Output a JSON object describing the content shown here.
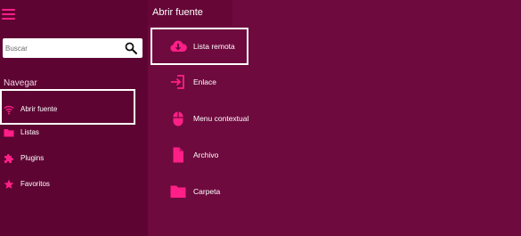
{
  "sidebar": {
    "search": {
      "placeholder": "Buscar",
      "value": ""
    },
    "nav_heading": "Navegar",
    "items": [
      {
        "label": "Abrir fuente",
        "icon": "wifi-icon"
      },
      {
        "label": "Listas",
        "icon": "folder-icon"
      },
      {
        "label": "Plugins",
        "icon": "puzzle-icon"
      },
      {
        "label": "Favoritos",
        "icon": "star-icon"
      }
    ]
  },
  "main": {
    "title": "Abrir fuente",
    "sources": [
      {
        "label": "Lista remota",
        "icon": "cloud-download-icon"
      },
      {
        "label": "Enlace",
        "icon": "login-arrow-icon"
      },
      {
        "label": "Menu contextual",
        "icon": "mouse-icon"
      },
      {
        "label": "Archivo",
        "icon": "file-icon"
      },
      {
        "label": "Carpeta",
        "icon": "folder-icon"
      }
    ]
  },
  "colors": {
    "accent": "#ff1f86",
    "background": "#6e0a3e",
    "sidebar": "#5e0433",
    "selection_border": "#ffffff"
  }
}
